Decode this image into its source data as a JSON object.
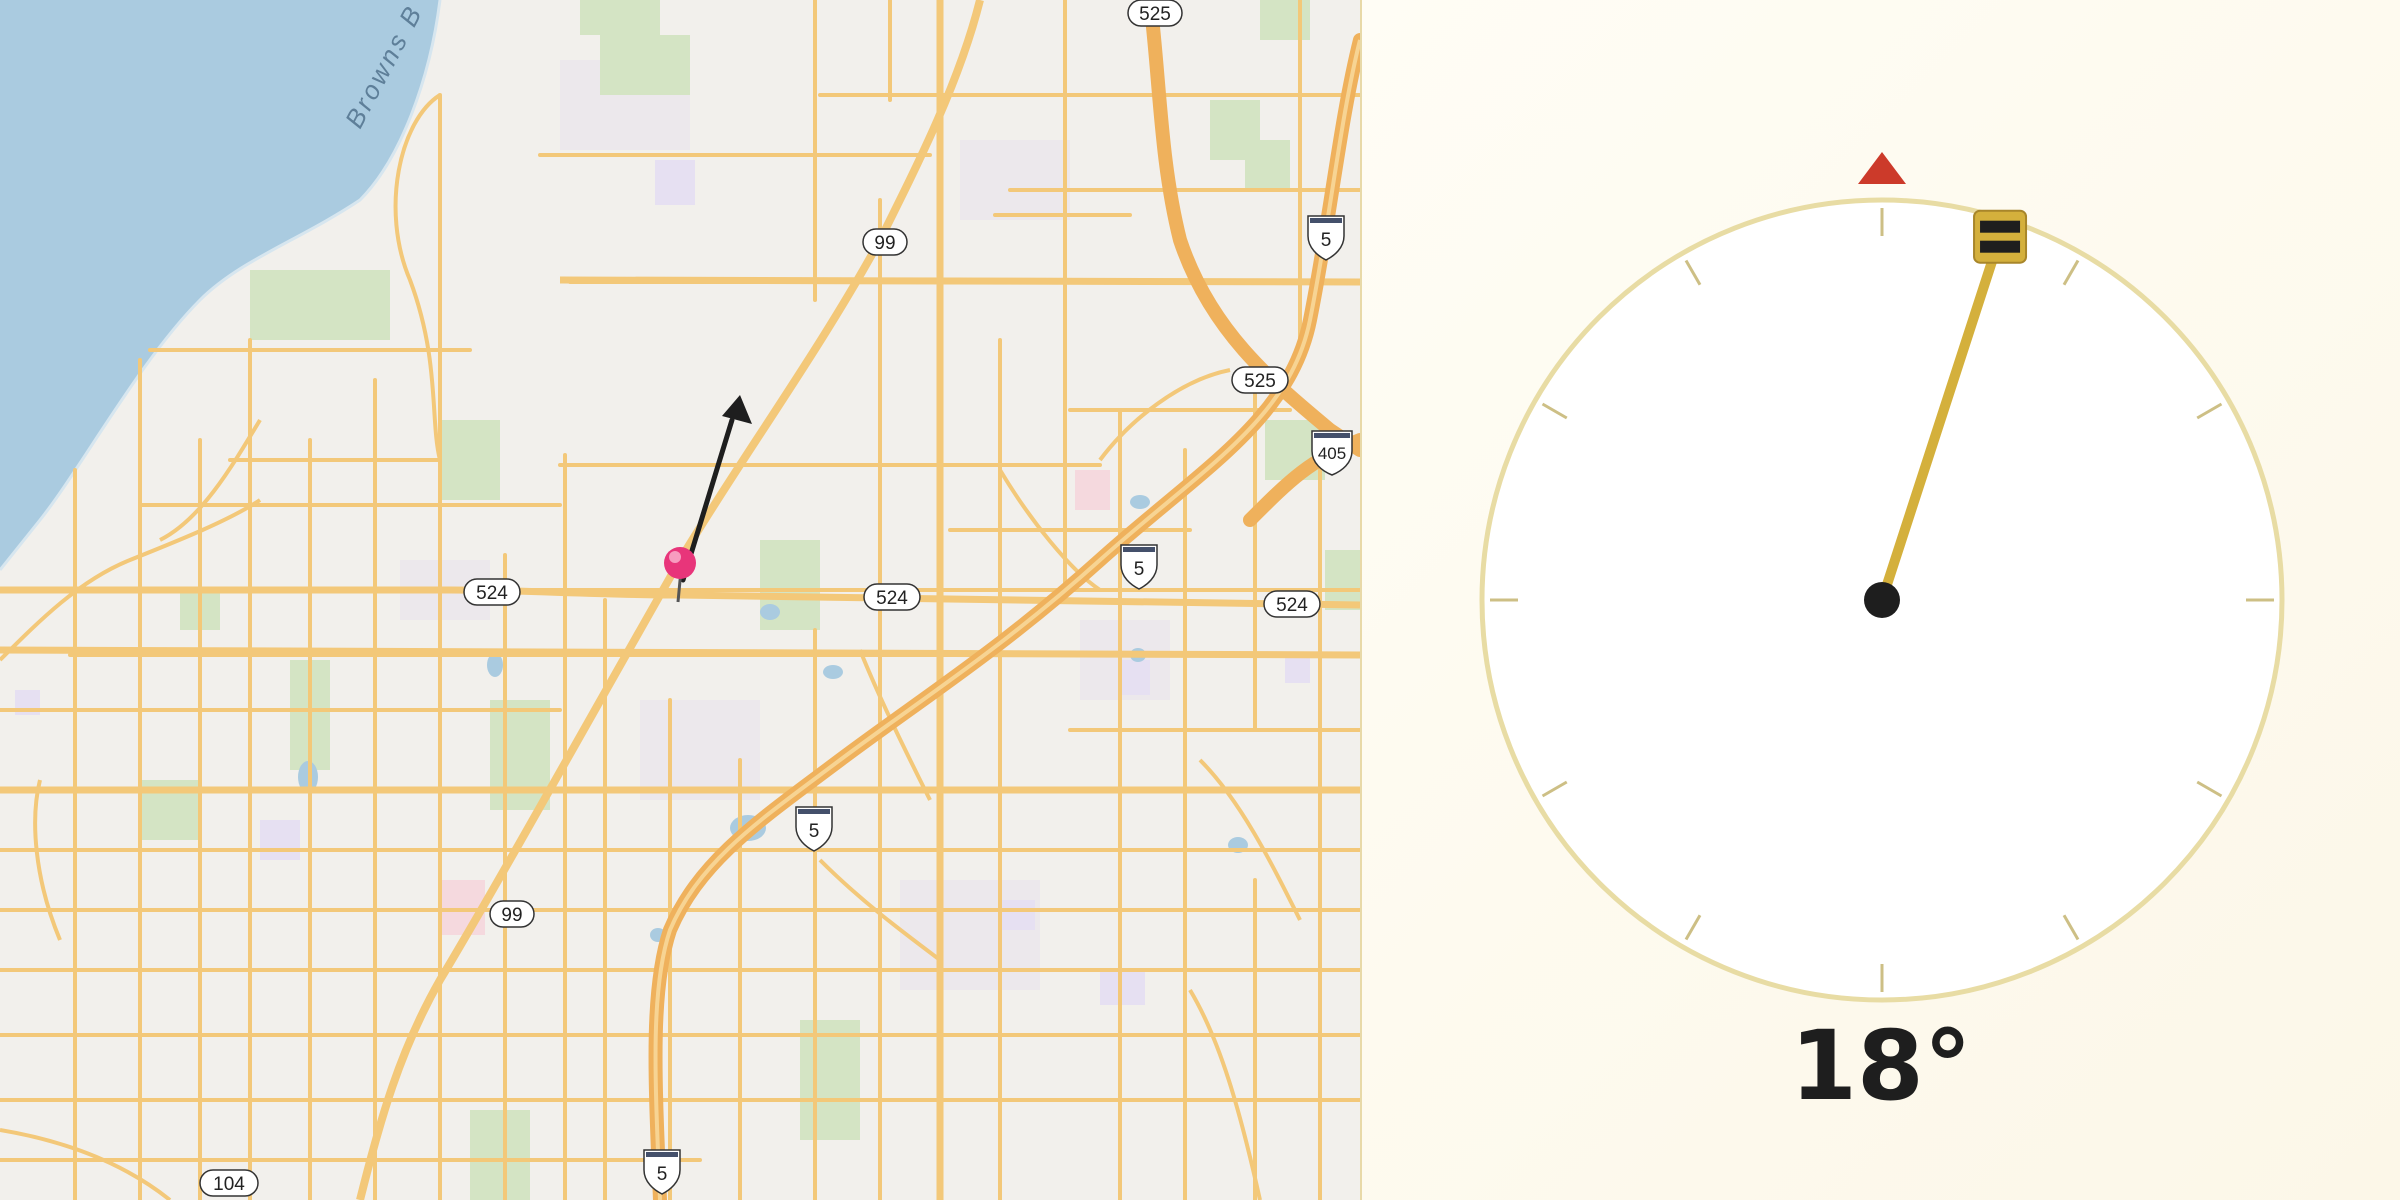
{
  "map": {
    "water_label": "Browns B",
    "route_labels": {
      "sr525_top": "525",
      "sr99_north": "99",
      "i5_north": "5",
      "sr525_mid": "525",
      "i405": "405",
      "sr524_west": "524",
      "sr524_mid": "524",
      "i5_mid": "5",
      "sr524_east": "524",
      "i5_south": "5",
      "sr99_south": "99",
      "i5_bottom": "5",
      "sr104": "104"
    },
    "marker_icon": "pin-icon",
    "direction_icon": "arrow-icon",
    "colors": {
      "water": "#aacbe0",
      "road": "#f3c879",
      "highway": "#efb15c",
      "park": "#d4e4c4",
      "pin": "#e8357a"
    }
  },
  "compass": {
    "heading": 18,
    "heading_text": "18°",
    "north_marker_icon": "north-triangle-icon",
    "colors": {
      "ring": "#e8dca4",
      "needle": "#d4b03c",
      "north": "#cc3a2a",
      "hub": "#1e1e1e"
    }
  }
}
